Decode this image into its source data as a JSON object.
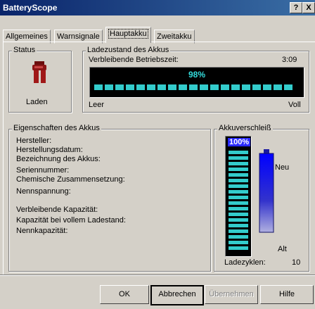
{
  "window": {
    "title": "BatteryScope",
    "help_btn": "?",
    "close_btn": "X"
  },
  "tabs": [
    "Allgemeines",
    "Warnsignale",
    "Hauptakku",
    "Zweitakku"
  ],
  "active_tab": "Hauptakku",
  "status": {
    "legend": "Status",
    "state": "Laden"
  },
  "charge": {
    "legend": "Ladezustand des Akkus",
    "remaining_label": "Verbleibende Betriebszeit:",
    "remaining_value": "3:09",
    "percent_text": "98%",
    "percent": 0.98,
    "min_label": "Leer",
    "max_label": "Voll"
  },
  "properties": {
    "legend": "Eigenschaften des Akkus",
    "fields": [
      "Hersteller:",
      "Herstellungsdatum:",
      "Bezeichnung des Akkus:",
      "Seriennummer:",
      "Chemische Zusammensetzung:",
      "Nennspannung:",
      "Verbleibende Kapazität:",
      "Kapazität bei vollem Ladestand:",
      "Nennkapazität:"
    ]
  },
  "wear": {
    "legend": "Akkuverschleiß",
    "percent_text": "100%",
    "percent": 1.0,
    "new_label": "Neu",
    "old_label": "Alt",
    "cycles_label": "Ladezyklen:",
    "cycles_value": "10"
  },
  "buttons": {
    "ok": "OK",
    "cancel": "Abbrechen",
    "apply": "Übernehmen",
    "help": "Hilfe"
  },
  "colors": {
    "title_start": "#0a246a",
    "title_end": "#3a6ea5",
    "bar_fill": "#33cccc",
    "bar_bg": "#003333",
    "wear_blue": "#2a2aff",
    "wear_text": "#ffffff"
  }
}
